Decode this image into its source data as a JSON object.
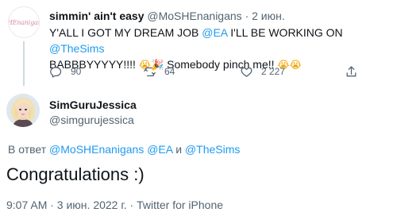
{
  "parent_tweet": {
    "avatar_text": "SHEnanigans",
    "display_name": "simmin' ain't easy",
    "handle": "@MoSHEnanigans",
    "separator": "·",
    "date": "2 июн.",
    "text_part1": "Y'ALL I GOT MY DREAM JOB ",
    "mention_ea": "@EA",
    "text_part2": " I'LL BE WORKING ON ",
    "mention_sims": "@TheSims",
    "text_part3": "BABBBYYYYY!!!! ",
    "emoji_sob_1": "😭",
    "emoji_party": "🎉",
    "text_part4": " Somebody pinch me!! ",
    "emoji_sob_2": "😭",
    "emoji_sob_3": "😭",
    "reply_count": "90",
    "retweet_count": "64",
    "like_count": "2 227"
  },
  "main_tweet": {
    "display_name": "SimGuruJessica",
    "handle": "@simgurujessica",
    "reply_prefix": "В ответ ",
    "reply_mention_1": "@MoSHEnanigans",
    "reply_mention_2": "@EA",
    "reply_and": " и ",
    "reply_mention_3": "@TheSims",
    "text": "Congratulations :)",
    "timestamp": "9:07 AM · 3 июн. 2022 г. · Twitter for iPhone"
  },
  "icons": {
    "reply": "reply-icon",
    "retweet": "retweet-icon",
    "like": "heart-icon",
    "share": "share-icon"
  },
  "colors": {
    "link": "#1d9bf0",
    "secondary_text": "#536471",
    "primary_text": "#0f1419"
  }
}
